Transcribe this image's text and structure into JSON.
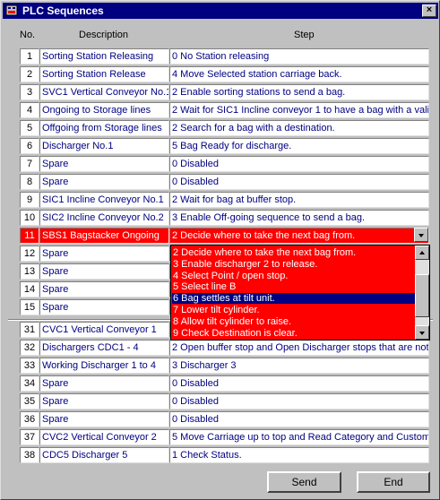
{
  "window": {
    "title": "PLC Sequences"
  },
  "headers": {
    "no": "No.",
    "description": "Description",
    "step": "Step"
  },
  "rows": [
    {
      "no": "1",
      "desc": "Sorting Station Releasing",
      "step": "0 No Station releasing"
    },
    {
      "no": "2",
      "desc": "Sorting Station Release",
      "step": "4 Move Selected station carriage back."
    },
    {
      "no": "3",
      "desc": "SVC1 Vertical Conveyor No.1",
      "step": "2 Enable sorting stations to send a bag."
    },
    {
      "no": "4",
      "desc": "Ongoing to Storage lines",
      "step": "2 Wait for SIC1 Incline conveyor 1 to have a bag with a valid"
    },
    {
      "no": "5",
      "desc": "Offgoing from Storage lines",
      "step": "2 Search for a bag with a destination."
    },
    {
      "no": "6",
      "desc": "Discharger No.1",
      "step": "5 Bag Ready for discharge."
    },
    {
      "no": "7",
      "desc": "Spare",
      "step": "0 Disabled"
    },
    {
      "no": "8",
      "desc": "Spare",
      "step": "0 Disabled"
    },
    {
      "no": "9",
      "desc": "SIC1 Incline Conveyor No.1",
      "step": "2 Wait for bag at buffer stop."
    },
    {
      "no": "10",
      "desc": "SIC2 Incline Conveyor No.2",
      "step": "3 Enable Off-going sequence to send a bag."
    },
    {
      "no": "11",
      "desc": "SBS1 Bagstacker Ongoing",
      "step": "2 Decide where to take the next bag from."
    },
    {
      "no": "12",
      "desc": "Spare",
      "step": ""
    },
    {
      "no": "13",
      "desc": "Spare",
      "step": ""
    },
    {
      "no": "14",
      "desc": "Spare",
      "step": ""
    },
    {
      "no": "15",
      "desc": "Spare",
      "step": ""
    },
    {
      "no": "31",
      "desc": "CVC1 Vertical Conveyor 1",
      "step": ""
    },
    {
      "no": "32",
      "desc": "Dischargers CDC1 - 4",
      "step": "2 Open buffer stop and Open Discharger stops that are not"
    },
    {
      "no": "33",
      "desc": "Working Discharger 1 to 4",
      "step": "3 Discharger 3"
    },
    {
      "no": "34",
      "desc": "Spare",
      "step": "0 Disabled"
    },
    {
      "no": "35",
      "desc": "Spare",
      "step": "0 Disabled"
    },
    {
      "no": "36",
      "desc": "Spare",
      "step": "0 Disabled"
    },
    {
      "no": "37",
      "desc": "CVC2 Vertical Conveyor 2",
      "step": "5 Move Carriage up to top and Read Category and Customer"
    },
    {
      "no": "38",
      "desc": "CDC5 Discharger 5",
      "step": "1 Check Status."
    }
  ],
  "dropdown_options": [
    "2 Decide where to take the next bag from.",
    "3 Enable discharger 2 to release.",
    "4 Select Point / open stop.",
    "5 Select line B",
    "6 Bag settles at tilt unit.",
    "7 Lower tilt cylinder.",
    "8 Allow tilt cylinder to raise.",
    "9 Check Destination is clear."
  ],
  "buttons": {
    "send": "Send",
    "end": "End"
  },
  "colors": {
    "selected_row": "#ff0000",
    "title_bar": "#000080",
    "highlight_option": "#000080"
  },
  "selected_row_no": "11",
  "highlighted_option_index": 4
}
